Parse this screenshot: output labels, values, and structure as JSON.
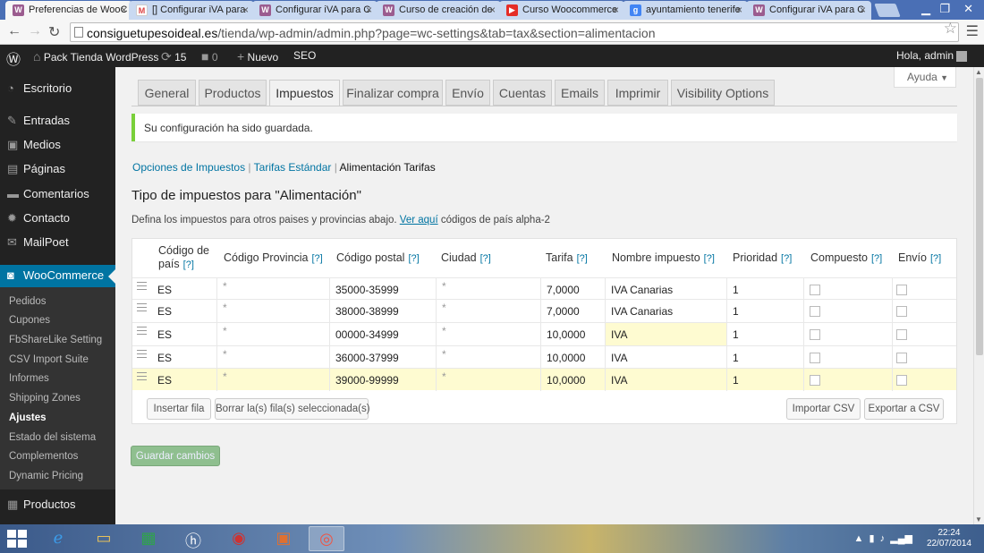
{
  "browser": {
    "tabs": [
      {
        "label": "Preferencias de WooC",
        "favicon": "W",
        "active": true
      },
      {
        "label": "[] Configurar iVA para",
        "favicon": "M",
        "active": false
      },
      {
        "label": "Configurar iVA para C",
        "favicon": "W",
        "active": false
      },
      {
        "label": "Curso de creación de",
        "favicon": "W",
        "active": false
      },
      {
        "label": "Curso Woocommerce",
        "favicon": "▶",
        "active": false
      },
      {
        "label": "ayuntamiento tenerife",
        "favicon": "g",
        "active": false
      },
      {
        "label": "Configurar iVA para C",
        "favicon": "W",
        "active": false
      }
    ],
    "url_host": "consiguetupesoideal.es",
    "url_path": "/tienda/wp-admin/admin.php?page=wc-settings&tab=tax&section=alimentacion"
  },
  "adminbar": {
    "site_name": "Pack Tienda WordPress",
    "updates": "15",
    "comments": "0",
    "new_label": "Nuevo",
    "seo_label": "SEO",
    "greeting": "Hola, admin"
  },
  "sidemenu": {
    "items": [
      "Escritorio",
      "Entradas",
      "Medios",
      "Páginas",
      "Comentarios",
      "Contacto",
      "MailPoet"
    ],
    "woocommerce": "WooCommerce",
    "submenu": [
      "Pedidos",
      "Cupones",
      "FbShareLike Setting",
      "CSV Import Suite",
      "Informes",
      "Shipping Zones",
      "Ajustes",
      "Estado del sistema",
      "Complementos",
      "Dynamic Pricing"
    ],
    "products": "Productos"
  },
  "help_label": "Ayuda",
  "settings_tabs": [
    "General",
    "Productos",
    "Impuestos",
    "Finalizar compra",
    "Envío",
    "Cuentas",
    "Emails",
    "Imprimir",
    "Visibility Options"
  ],
  "notice": "Su configuración ha sido guardada.",
  "subnav": {
    "link1": "Opciones de Impuestos",
    "link2": "Tarifas Estándar",
    "current": "Alimentación Tarifas",
    "sep": "|"
  },
  "section": {
    "title": "Tipo de impuestos para \"Alimentación\"",
    "desc_before": "Defina los impuestos para otros paises y provincias abajo. ",
    "desc_link": "Ver aquí",
    "desc_after": " códigos de país alpha-2"
  },
  "table": {
    "headers": {
      "country_1": "Código de",
      "country_2": "país",
      "state": "Código Provincia",
      "postcode": "Código postal",
      "city": "Ciudad",
      "rate": "Tarifa",
      "name": "Nombre impuesto",
      "priority": "Prioridad",
      "compound": "Compuesto",
      "shipping": "Envío",
      "hint": "[?]"
    },
    "rows": [
      {
        "country": "ES",
        "state": "*",
        "postcode": "35000-35999",
        "city": "*",
        "rate": "7,0000",
        "name": "IVA Canarias",
        "priority": "1"
      },
      {
        "country": "ES",
        "state": "*",
        "postcode": "38000-38999",
        "city": "*",
        "rate": "7,0000",
        "name": "IVA Canarias",
        "priority": "1"
      },
      {
        "country": "ES",
        "state": "*",
        "postcode": "00000-34999",
        "city": "*",
        "rate": "10,0000",
        "name": "IVA",
        "priority": "1"
      },
      {
        "country": "ES",
        "state": "*",
        "postcode": "36000-37999",
        "city": "*",
        "rate": "10,0000",
        "name": "IVA",
        "priority": "1"
      },
      {
        "country": "ES",
        "state": "*",
        "postcode": "39000-99999",
        "city": "*",
        "rate": "10,0000",
        "name": "IVA",
        "priority": "1"
      }
    ],
    "insert_row": "Insertar fila",
    "remove_rows": "Borrar la(s) fila(s) seleccionada(s)",
    "import_csv": "Importar CSV",
    "export_csv": "Exportar a CSV"
  },
  "save_label": "Guardar cambios",
  "taskbar": {
    "time": "22:24",
    "date": "22/07/2014"
  },
  "colors": {
    "accent": "#0074a2",
    "admin_dark": "#222222",
    "notice_green": "#7ad03a",
    "highlight": "#fefbd1"
  }
}
